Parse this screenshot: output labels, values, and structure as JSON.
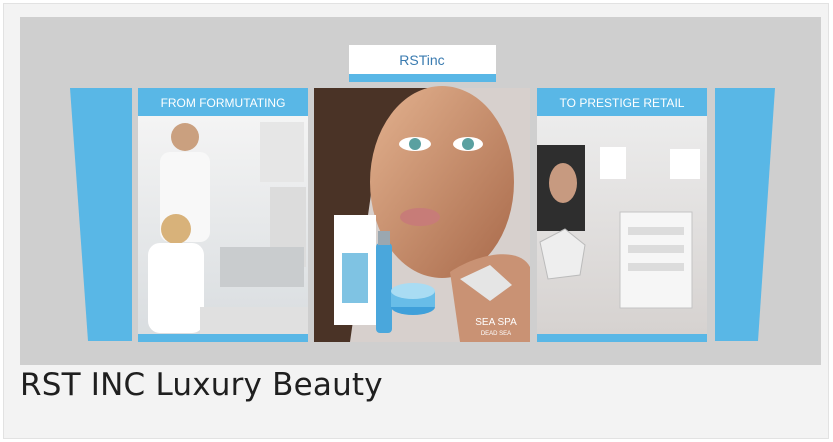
{
  "card": {
    "caption": "RST INC Luxury Beauty"
  },
  "booth": {
    "logo_text": "RSTinc",
    "left_banner": "FROM FORMUTATING",
    "right_banner": "TO PRESTIGE RETAIL",
    "product_brand": "SEA SPA",
    "product_tagline": "DEAD SEA"
  },
  "colors": {
    "accent_blue": "#59b7e6",
    "background_gray": "#cfcfcf"
  }
}
